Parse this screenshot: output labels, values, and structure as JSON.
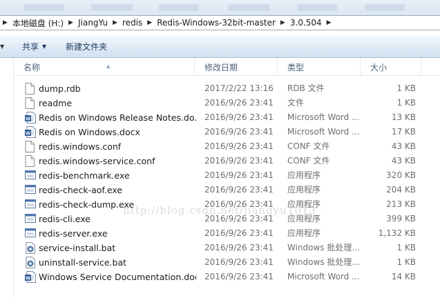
{
  "breadcrumb": {
    "items": [
      "本地磁盘 (H:)",
      "JiangYu",
      "redis",
      "Redis-Windows-32bit-master",
      "3.0.504"
    ]
  },
  "toolbar": {
    "share_label": "共享",
    "new_folder_label": "新建文件夹"
  },
  "columns": {
    "name": "名称",
    "date": "修改日期",
    "type": "类型",
    "size": "大小"
  },
  "files": [
    {
      "name": "dump.rdb",
      "date": "2017/2/22 13:16",
      "type": "RDB 文件",
      "size": "1 KB",
      "icon": "file-icon"
    },
    {
      "name": "readme",
      "date": "2016/9/26 23:41",
      "type": "文件",
      "size": "1 KB",
      "icon": "file-icon"
    },
    {
      "name": "Redis on Windows Release Notes.do...",
      "date": "2016/9/26 23:41",
      "type": "Microsoft Word ...",
      "size": "13 KB",
      "icon": "word-doc-icon"
    },
    {
      "name": "Redis on Windows.docx",
      "date": "2016/9/26 23:41",
      "type": "Microsoft Word ...",
      "size": "17 KB",
      "icon": "word-doc-icon"
    },
    {
      "name": "redis.windows.conf",
      "date": "2016/9/26 23:41",
      "type": "CONF 文件",
      "size": "43 KB",
      "icon": "file-icon"
    },
    {
      "name": "redis.windows-service.conf",
      "date": "2016/9/26 23:41",
      "type": "CONF 文件",
      "size": "43 KB",
      "icon": "file-icon"
    },
    {
      "name": "redis-benchmark.exe",
      "date": "2016/9/26 23:41",
      "type": "应用程序",
      "size": "320 KB",
      "icon": "exe-icon"
    },
    {
      "name": "redis-check-aof.exe",
      "date": "2016/9/26 23:41",
      "type": "应用程序",
      "size": "204 KB",
      "icon": "exe-icon"
    },
    {
      "name": "redis-check-dump.exe",
      "date": "2016/9/26 23:41",
      "type": "应用程序",
      "size": "213 KB",
      "icon": "exe-icon"
    },
    {
      "name": "redis-cli.exe",
      "date": "2016/9/26 23:41",
      "type": "应用程序",
      "size": "399 KB",
      "icon": "exe-icon"
    },
    {
      "name": "redis-server.exe",
      "date": "2016/9/26 23:41",
      "type": "应用程序",
      "size": "1,132 KB",
      "icon": "exe-icon"
    },
    {
      "name": "service-install.bat",
      "date": "2016/9/26 23:41",
      "type": "Windows 批处理...",
      "size": "1 KB",
      "icon": "bat-gear-icon"
    },
    {
      "name": "uninstall-service.bat",
      "date": "2016/9/26 23:41",
      "type": "Windows 批处理...",
      "size": "1 KB",
      "icon": "bat-gear-icon"
    },
    {
      "name": "Windows Service Documentation.docx",
      "date": "2016/9/26 23:41",
      "type": "Microsoft Word ...",
      "size": "14 KB",
      "icon": "word-doc-icon"
    }
  ],
  "watermark": "http://blog.csdn.net/jiangyu1013",
  "colors": {
    "header_text": "#4c607a",
    "meta_text": "#6d6d6d",
    "command_text": "#1e395b"
  }
}
